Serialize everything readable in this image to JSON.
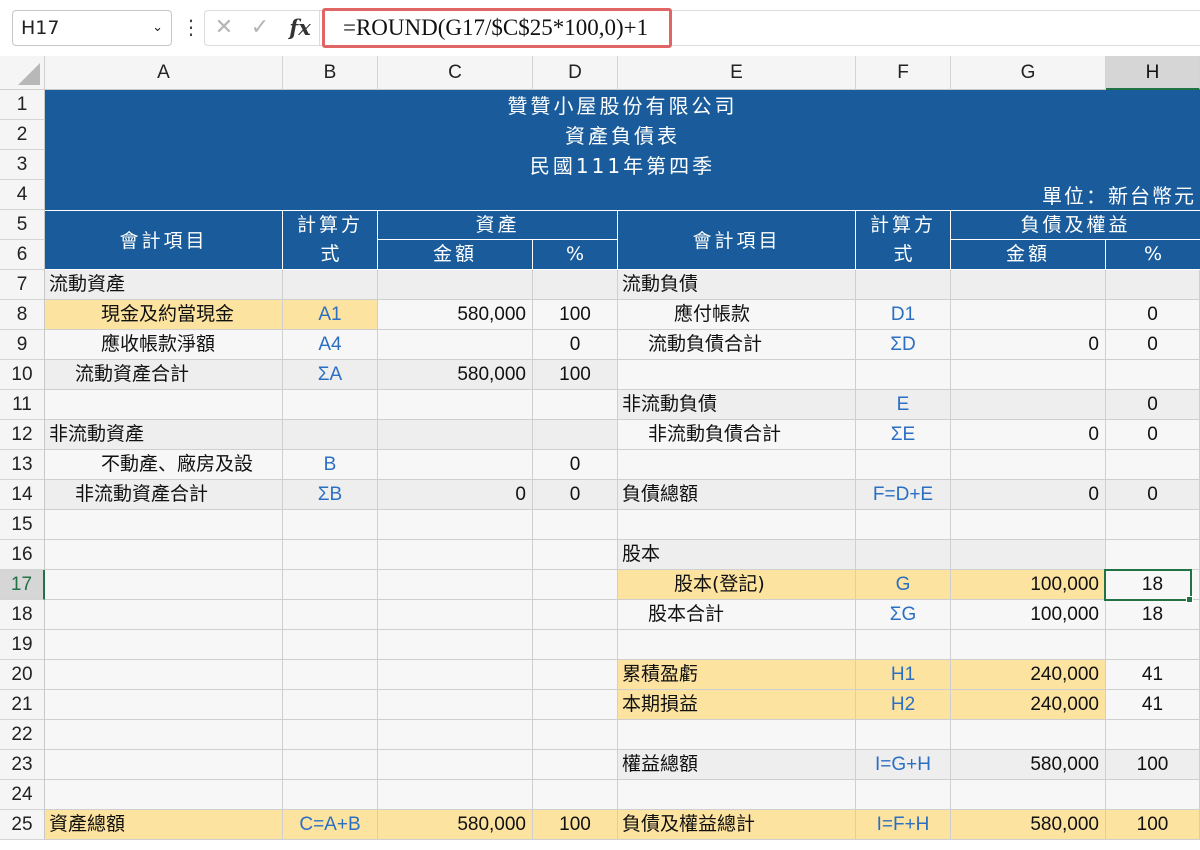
{
  "formula_bar": {
    "name_box": "H17",
    "formula": "=ROUND(G17/$C$25*100,0)+1",
    "fx_label": "fx"
  },
  "columns": [
    "A",
    "B",
    "C",
    "D",
    "E",
    "F",
    "G",
    "H"
  ],
  "rows": [
    "1",
    "2",
    "3",
    "4",
    "5",
    "6",
    "7",
    "8",
    "9",
    "10",
    "11",
    "12",
    "13",
    "14",
    "15",
    "16",
    "17",
    "18",
    "19",
    "20",
    "21",
    "22",
    "23",
    "24",
    "25"
  ],
  "header": {
    "company": "贊贊小屋股份有限公司",
    "report": "資產負債表",
    "period": "民國111年第四季",
    "unit": "單位：新台幣元",
    "acct_item": "會計項目",
    "calc_method_1": "計算方",
    "calc_method_2": "式",
    "assets": "資產",
    "liab_equity": "負債及權益",
    "amount": "金額",
    "pct": "%"
  },
  "left": {
    "r7": {
      "a": "流動資產"
    },
    "r8": {
      "a": "現金及約當現金",
      "b": "A1",
      "c": "580,000",
      "d": "100"
    },
    "r9": {
      "a": "應收帳款淨額",
      "b": "A4",
      "d": "0"
    },
    "r10": {
      "a": "流動資產合計",
      "b": "ΣA",
      "c": "580,000",
      "d": "100"
    },
    "r12": {
      "a": "非流動資產"
    },
    "r13": {
      "a": "不動產、廠房及設",
      "b": "B",
      "d": "0"
    },
    "r14": {
      "a": "非流動資產合計",
      "b": "ΣB",
      "c": "0",
      "d": "0"
    },
    "r25": {
      "a": "資產總額",
      "b": "C=A+B",
      "c": "580,000",
      "d": "100"
    }
  },
  "right": {
    "r7": {
      "e": "流動負債"
    },
    "r8": {
      "e": "應付帳款",
      "f": "D1",
      "h": "0"
    },
    "r9": {
      "e": "流動負債合計",
      "f": "ΣD",
      "g": "0",
      "h": "0"
    },
    "r11": {
      "e": "非流動負債",
      "f": "E",
      "h": "0"
    },
    "r12": {
      "e": "非流動負債合計",
      "f": "ΣE",
      "g": "0",
      "h": "0"
    },
    "r14": {
      "e": "負債總額",
      "f": "F=D+E",
      "g": "0",
      "h": "0"
    },
    "r16": {
      "e": "股本"
    },
    "r17": {
      "e": "股本(登記)",
      "f": "G",
      "g": "100,000",
      "h": "18"
    },
    "r18": {
      "e": "股本合計",
      "f": "ΣG",
      "g": "100,000",
      "h": "18"
    },
    "r20": {
      "e": "累積盈虧",
      "f": "H1",
      "g": "240,000",
      "h": "41"
    },
    "r21": {
      "e": "本期損益",
      "f": "H2",
      "g": "240,000",
      "h": "41"
    },
    "r23": {
      "e": "權益總額",
      "f": "I=G+H",
      "g": "580,000",
      "h": "100"
    },
    "r25": {
      "e": "負債及權益總計",
      "f": "I=F+H",
      "g": "580,000",
      "h": "100"
    }
  }
}
